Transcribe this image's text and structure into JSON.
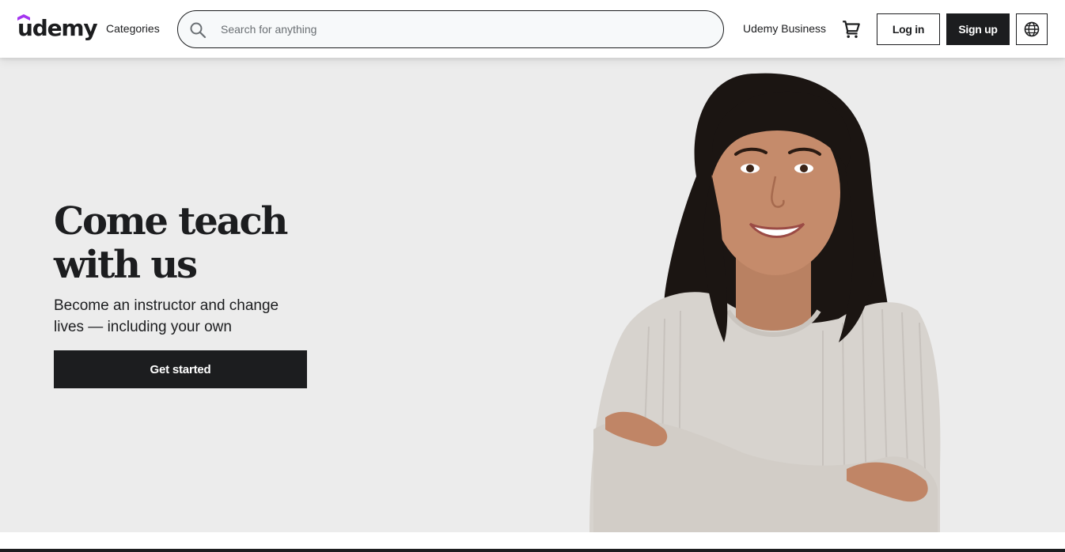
{
  "header": {
    "logo_text": "udemy",
    "categories_label": "Categories",
    "search": {
      "placeholder": "Search for anything",
      "value": ""
    },
    "business_label": "Udemy Business",
    "cart_icon": "shopping-cart-icon",
    "login_label": "Log in",
    "signup_label": "Sign up",
    "language_icon": "globe-icon"
  },
  "hero": {
    "title_line1": "Come teach",
    "title_line2": "with us",
    "subtitle": "Become an instructor and change lives — including your own",
    "cta_label": "Get started",
    "image_description_icon": "instructor-portrait"
  },
  "colors": {
    "brand_purple": "#a435f0",
    "text_dark": "#1c1d1f",
    "hero_background": "#ececec",
    "search_background": "#f7f9fa",
    "placeholder_gray": "#6a6f73"
  }
}
